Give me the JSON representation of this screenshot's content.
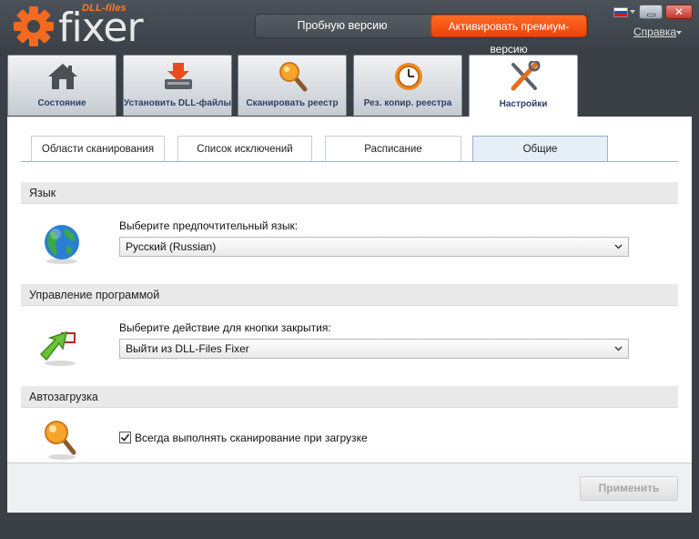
{
  "window": {
    "brand_small": "DLL-files",
    "brand_big": "fixer",
    "trial_label": "Пробную версию",
    "premium_label": "Активировать премиум-версию",
    "help_label": "Справка",
    "close_glyph": "✕",
    "accent_color": "#f25a1b"
  },
  "main_tabs": [
    {
      "label": "Состояние",
      "icon": "home-icon"
    },
    {
      "label": "Установить DLL-файлы",
      "icon": "install-dll-icon"
    },
    {
      "label": "Сканировать реестр",
      "icon": "scan-registry-icon"
    },
    {
      "label": "Рез. копир. реестра",
      "icon": "registry-backup-icon"
    },
    {
      "label": "Настройки",
      "icon": "settings-tools-icon",
      "active": true
    }
  ],
  "sub_tabs": [
    {
      "label": "Области сканирования"
    },
    {
      "label": "Список исключений"
    },
    {
      "label": "Расписание"
    },
    {
      "label": "Общие",
      "active": true
    }
  ],
  "sections": {
    "language": {
      "title": "Язык",
      "icon": "globe-icon",
      "field_label": "Выберите предпочтительный язык:",
      "selected": "Русский (Russian)"
    },
    "program": {
      "title": "Управление программой",
      "icon": "exit-arrow-icon",
      "field_label": "Выберите действие для кнопки закрытия:",
      "selected": "Выйти из DLL-Files Fixer"
    },
    "autostart": {
      "title": "Автозагрузка",
      "icon": "magnifier-icon",
      "checkbox_label": "Всегда выполнять сканирование при загрузке",
      "checked": true
    }
  },
  "footer": {
    "apply_label": "Применить"
  }
}
